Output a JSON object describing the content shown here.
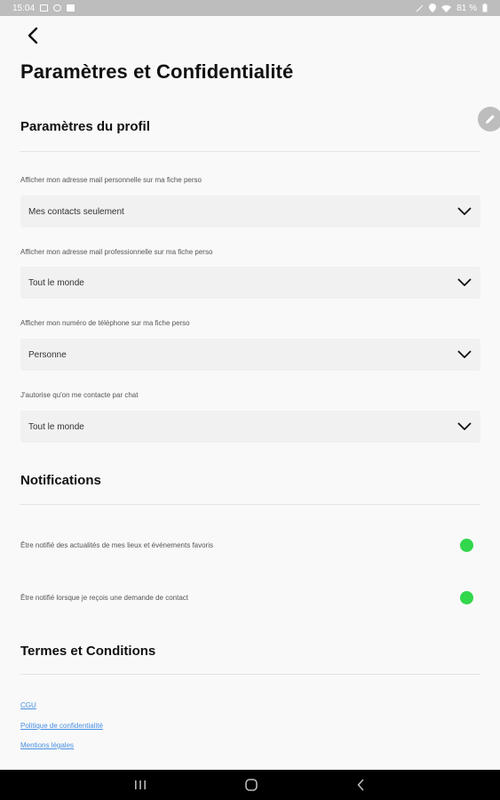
{
  "status_bar": {
    "time": "15:04",
    "battery": "81 %"
  },
  "page": {
    "title": "Paramètres et Confidentialité"
  },
  "profile": {
    "title": "Paramètres du profil",
    "fields": [
      {
        "label": "Afficher mon adresse mail personnelle sur ma fiche perso",
        "value": "Mes contacts seulement"
      },
      {
        "label": "Afficher mon adresse mail professionnelle sur ma fiche perso",
        "value": "Tout le monde"
      },
      {
        "label": "Afficher mon numéro de téléphone sur ma fiche perso",
        "value": "Personne"
      },
      {
        "label": "J'autorise qu'on me contacte par chat",
        "value": "Tout le monde"
      }
    ]
  },
  "notifications": {
    "title": "Notifications",
    "items": [
      {
        "label": "Être notifié des actualités de mes lieux et événements favoris",
        "enabled": true
      },
      {
        "label": "Être notifié lorsque je reçois une demande de contact",
        "enabled": true
      }
    ],
    "toggle_color": "#32d74b"
  },
  "terms": {
    "title": "Termes et Conditions",
    "links": [
      "CGU",
      "Politique de confidentialité",
      "Mentions légales"
    ],
    "link_color": "#4a90e2"
  },
  "icons": {
    "back": "chevron-left-icon",
    "edit": "pencil-icon",
    "select": "chevron-down-icon",
    "nav": [
      "recent-apps-icon",
      "home-icon",
      "back-icon"
    ]
  }
}
